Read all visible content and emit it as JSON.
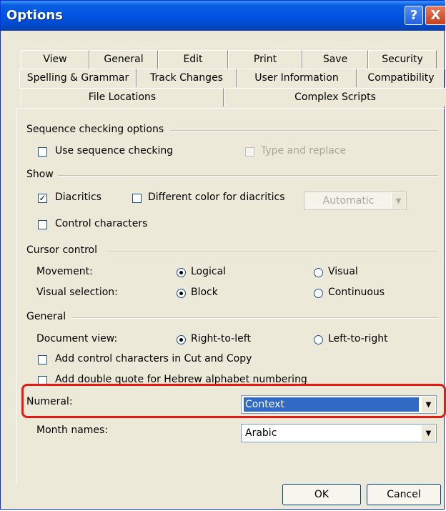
{
  "title": "Options",
  "titlebar": {
    "help_label": "?",
    "close_label": "X"
  },
  "tabs": {
    "row1": [
      "View",
      "General",
      "Edit",
      "Print",
      "Save",
      "Security"
    ],
    "row2": [
      "Spelling & Grammar",
      "Track Changes",
      "User Information",
      "Compatibility"
    ],
    "row3": [
      "File Locations",
      "Complex Scripts"
    ],
    "active": "Complex Scripts"
  },
  "sequence": {
    "label": "Sequence checking options",
    "use_seq": {
      "label": "Use sequence checking",
      "checked": false
    },
    "type_replace": {
      "label": "Type and replace",
      "checked": false,
      "disabled": true
    }
  },
  "show": {
    "label": "Show",
    "diacritics": {
      "label": "Diacritics",
      "checked": true
    },
    "diff_color": {
      "label": "Different color for diacritics",
      "checked": false
    },
    "color_combo": {
      "value": "Automatic",
      "disabled": true
    },
    "control_chars": {
      "label": "Control characters",
      "checked": false
    }
  },
  "cursor": {
    "label": "Cursor control",
    "movement": {
      "label": "Movement:",
      "opt1": "Logical",
      "opt2": "Visual",
      "selected": "Logical"
    },
    "visual_selection": {
      "label": "Visual selection:",
      "opt1": "Block",
      "opt2": "Continuous",
      "selected": "Block"
    }
  },
  "general": {
    "label": "General",
    "doc_view": {
      "label": "Document view:",
      "opt1": "Right-to-left",
      "opt2": "Left-to-right",
      "selected": "Right-to-left"
    },
    "add_ctrl": {
      "label": "Add control characters in Cut and Copy",
      "checked": false
    },
    "add_quote": {
      "label": "Add double quote for Hebrew alphabet numbering",
      "checked": false
    },
    "numeral": {
      "label": "Numeral:",
      "value": "Context"
    },
    "month": {
      "label": "Month names:",
      "value": "Arabic"
    }
  },
  "buttons": {
    "ok": "OK",
    "cancel": "Cancel"
  },
  "colors": {
    "titlebar": "#0054e3",
    "dialog_bg": "#ece9d8",
    "selection": "#316ac5",
    "highlight": "#e31b12"
  }
}
